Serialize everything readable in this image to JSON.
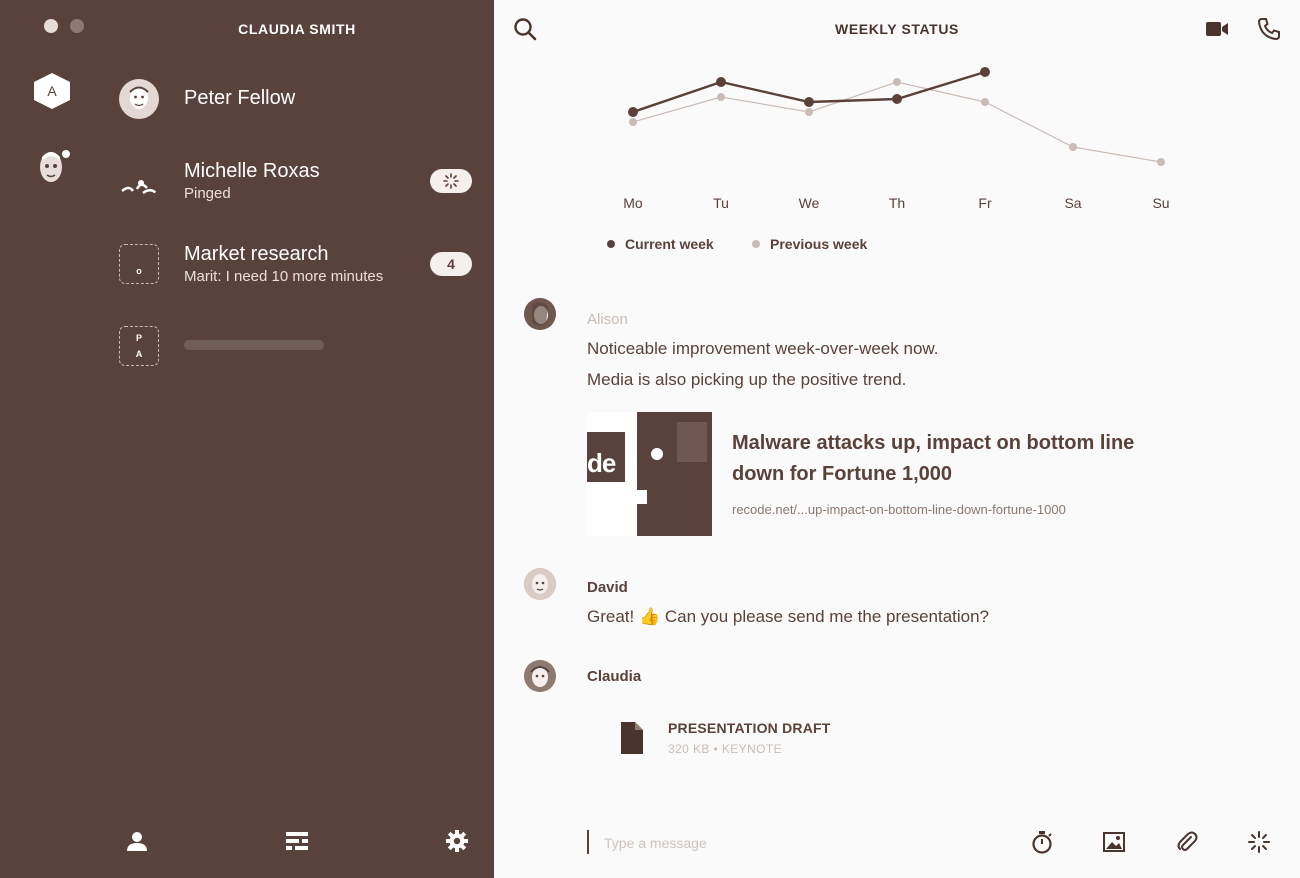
{
  "window": {
    "dots": [
      "close",
      "minimize"
    ]
  },
  "sidebar": {
    "user_name": "CLAUDIA SMITH",
    "workspace_label": "A",
    "chats": [
      {
        "name": "Peter Fellow",
        "subtitle": "",
        "badge": ""
      },
      {
        "name": "Michelle Roxas",
        "subtitle": "Pinged",
        "badge_icon": "ping-icon"
      },
      {
        "name": "Market research",
        "subtitle": "Marit: I need 10 more minutes",
        "badge": "4",
        "avatar_letter": "o"
      },
      {
        "name": "",
        "subtitle": "",
        "avatar_letters": [
          "P",
          "A"
        ]
      }
    ],
    "bottom_icons": [
      "profile-icon",
      "list-icon",
      "settings-icon"
    ]
  },
  "main": {
    "title": "WEEKLY STATUS",
    "top_icons": [
      "search-icon",
      "video-call-icon",
      "phone-icon"
    ]
  },
  "chart_data": {
    "type": "line",
    "categories": [
      "Mo",
      "Tu",
      "We",
      "Th",
      "Fr",
      "Sa",
      "Su"
    ],
    "series": [
      {
        "name": "Current week",
        "values": [
          7,
          10,
          8,
          8.3,
          11,
          null,
          null
        ],
        "color": "#5a4139"
      },
      {
        "name": "Previous week",
        "values": [
          6,
          8.5,
          7,
          10,
          8,
          3.5,
          2
        ],
        "color": "#c9bcb7"
      }
    ],
    "ylim": [
      0,
      12
    ],
    "grid": false,
    "legend_position": "bottom-left"
  },
  "messages": [
    {
      "author": "Alison",
      "lines": [
        "Noticeable improvement week-over-week now.",
        "Media is also picking up the positive trend."
      ],
      "link": {
        "title": "Malware attacks up, impact on bottom line down for Fortune 1,000",
        "url": "recode.net/...up-impact-on-bottom-line-down-fortune-1000",
        "image_text": "de"
      }
    },
    {
      "author": "David",
      "lines": [
        "Great! 👍 Can you please send me the presentation?"
      ]
    },
    {
      "author": "Claudia",
      "file": {
        "name": "PRESENTATION DRAFT",
        "meta": "320 KB • KEYNOTE"
      }
    }
  ],
  "composer": {
    "placeholder": "Type a message",
    "icons": [
      "timer-icon",
      "image-icon",
      "attachment-icon",
      "ping-icon"
    ]
  },
  "colors": {
    "sidebar_bg": "#59423b",
    "main_bg": "#fbfafa",
    "accent": "#5a4139",
    "muted": "#c9bcb7"
  }
}
